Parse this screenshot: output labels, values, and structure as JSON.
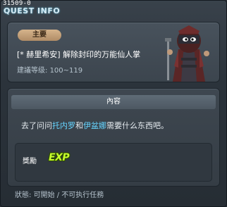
{
  "window": {
    "quest_id": "31509-0",
    "title": "QUEST INFO"
  },
  "summary": {
    "badge": "主要",
    "quest_title": "[* 赫里希安] 解除封印的万能仙人掌",
    "level_label": "建議等级:",
    "level_range": "100~119"
  },
  "npc_portrait": {
    "icon": "npc-portrait"
  },
  "content": {
    "header": "內容",
    "text_before": "去了问问",
    "npc1": "托内罗",
    "text_and": "和",
    "npc2": "伊盆娜",
    "text_after": "需要什么东西吧。",
    "npc_color": "#66d5ff"
  },
  "reward": {
    "label": "獎勵",
    "icon": "exp-icon",
    "icon_text": "EXP"
  },
  "status": {
    "text": "狀態: 可開始 / 不可执行任務"
  }
}
